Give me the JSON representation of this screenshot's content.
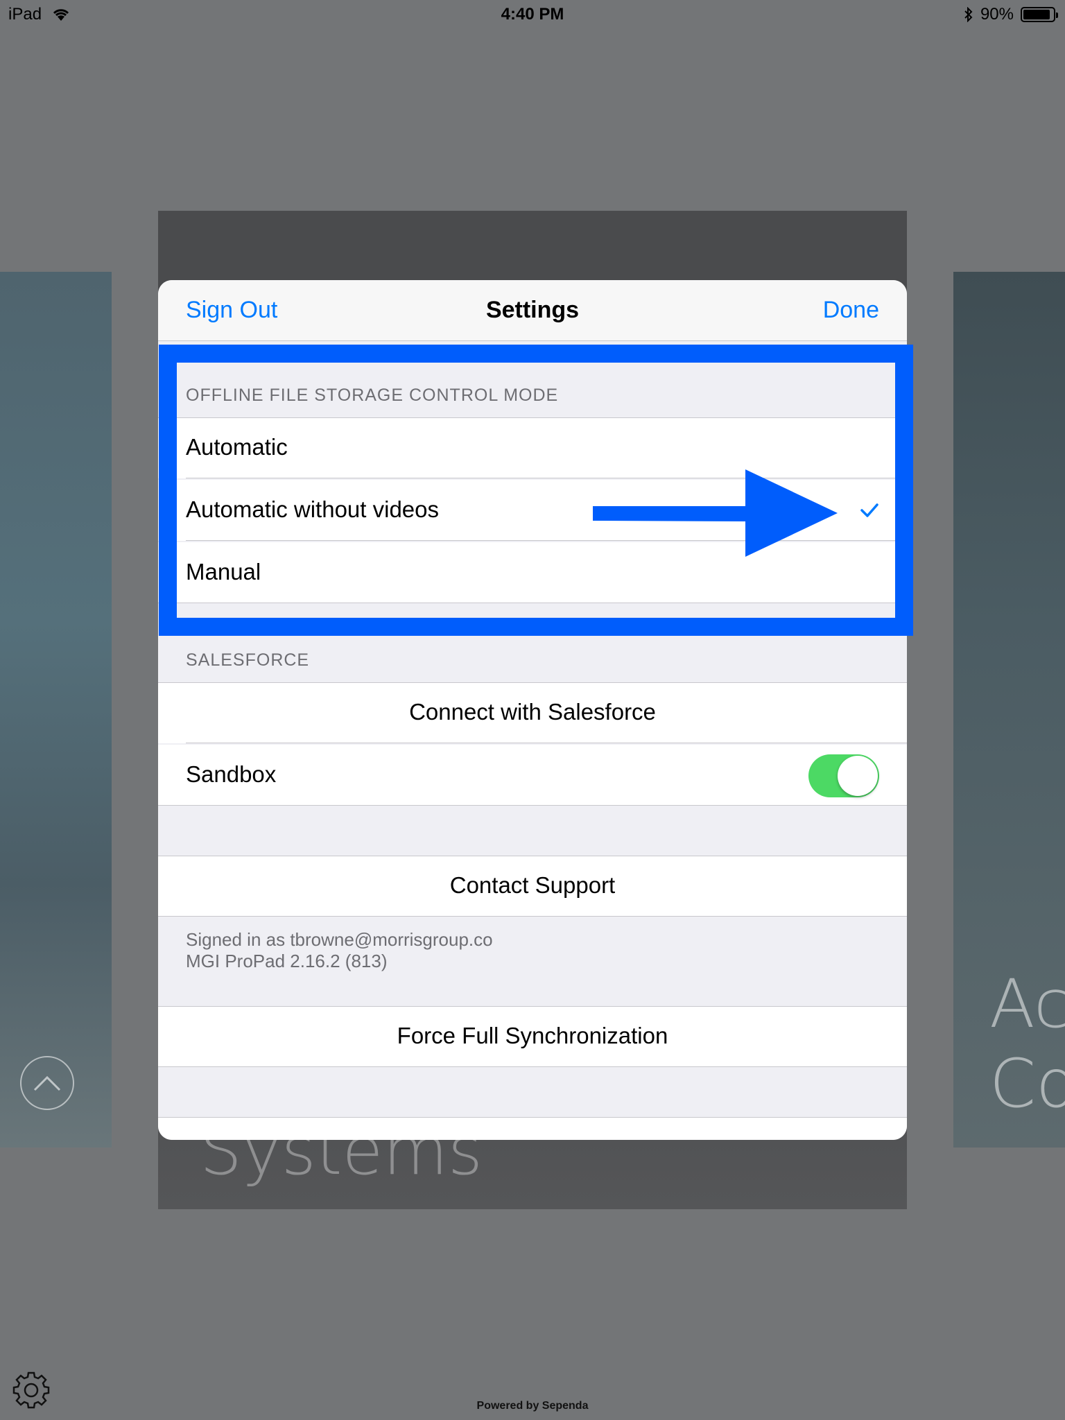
{
  "status_bar": {
    "device": "iPad",
    "time": "4:40 PM",
    "battery": "90%",
    "battery_level": 0.9
  },
  "background": {
    "center_title": "Systems",
    "right_text_line1": "Ac",
    "right_text_line2": "Co"
  },
  "navbar": {
    "left_button": "Sign Out",
    "title": "Settings",
    "right_button": "Done"
  },
  "offline_section": {
    "header": "OFFLINE FILE STORAGE CONTROL MODE",
    "options": [
      {
        "label": "Automatic",
        "selected": false
      },
      {
        "label": "Automatic without videos",
        "selected": true
      },
      {
        "label": "Manual",
        "selected": false
      }
    ]
  },
  "salesforce_section": {
    "header": "SALESFORCE",
    "connect_label": "Connect with Salesforce",
    "sandbox_label": "Sandbox",
    "sandbox_on": true
  },
  "support": {
    "contact_label": "Contact Support",
    "signed_in": "Signed in as tbrowne@morrisgroup.co",
    "version": "MGI ProPad 2.16.2 (813)"
  },
  "sync": {
    "force_sync_label": "Force Full Synchronization"
  },
  "footer": {
    "powered_by": "Powered by Sependa"
  },
  "colors": {
    "accent": "#007aff",
    "toggle_on": "#4cd964",
    "annotation": "#005dfc"
  }
}
